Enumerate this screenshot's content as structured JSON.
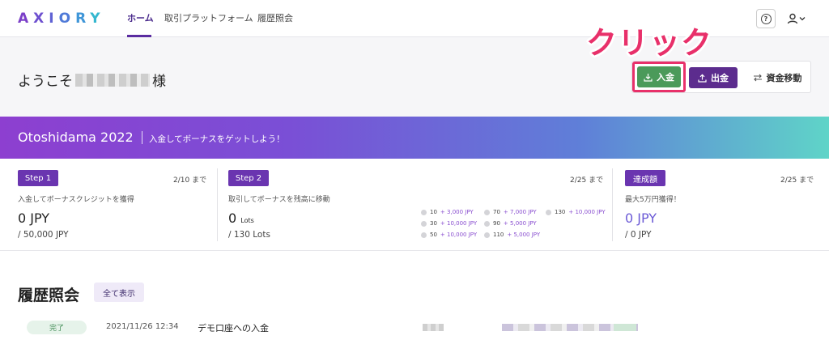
{
  "header": {
    "logo": "AXIORY",
    "nav": [
      "ホーム",
      "取引プラットフォーム",
      "履歴照会"
    ],
    "help_symbol": "?"
  },
  "welcome": {
    "prefix": "ようこそ",
    "suffix": "様",
    "deposit_label": "入金",
    "withdraw_label": "出金",
    "transfer_label": "資金移動",
    "annotation": "クリック"
  },
  "banner": {
    "title": "Otoshidama 2022",
    "subtitle": "入金してボーナスをゲットしよう！"
  },
  "steps": [
    {
      "tag": "Step 1",
      "due": "2/10 まで",
      "desc": "入金してボーナスクレジットを獲得",
      "value": "0 JPY",
      "total": "/ 50,000 JPY"
    },
    {
      "tag": "Step 2",
      "due": "2/25 まで",
      "desc": "取引してボーナスを残高に移動",
      "value": "0",
      "value_unit": "Lots",
      "total": "/ 130 Lots",
      "tiers": [
        {
          "lots": "10",
          "bonus": "+ 3,000 JPY"
        },
        {
          "lots": "30",
          "bonus": "+ 10,000 JPY"
        },
        {
          "lots": "50",
          "bonus": "+ 10,000 JPY"
        },
        {
          "lots": "70",
          "bonus": "+ 7,000 JPY"
        },
        {
          "lots": "90",
          "bonus": "+ 5,000 JPY"
        },
        {
          "lots": "110",
          "bonus": "+ 5,000 JPY"
        },
        {
          "lots": "130",
          "bonus": "+ 10,000 JPY"
        }
      ]
    },
    {
      "tag": "達成額",
      "due": "2/25 まで",
      "desc": "最大5万円獲得！",
      "value": "0 JPY",
      "total": "/ 0 JPY"
    }
  ],
  "history": {
    "title": "履歴照会",
    "show_all": "全て表示",
    "rows": [
      {
        "status": "完了",
        "date": "2021/11/26 12:34",
        "description": "デモ口座への入金"
      }
    ]
  },
  "colors": {
    "brand_purple": "#5c2c8e",
    "deposit_green": "#4b9a5a",
    "highlight_pink": "#e8306a"
  }
}
